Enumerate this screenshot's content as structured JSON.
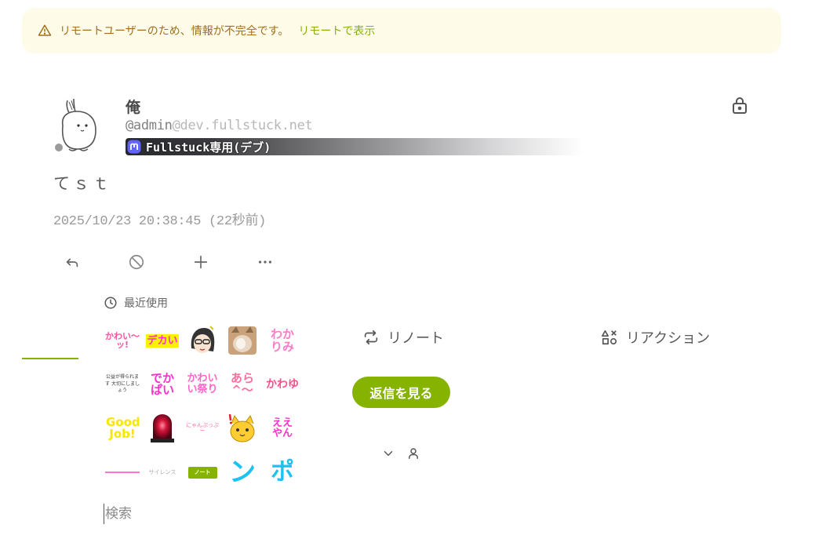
{
  "banner": {
    "message": "リモートユーザーのため、情報が不完全です。",
    "link": "リモートで表示",
    "icon": "warning-icon"
  },
  "note": {
    "display_name": "俺",
    "username": "@admin",
    "host": "@dev.fullstuck.net",
    "instance_name": "Fullstuck専用(デブ)",
    "text": "てｓｔ",
    "date": "2025/10/23 20:38:45 (22秒前)"
  },
  "actions": [
    {
      "name": "reply-icon"
    },
    {
      "name": "renote-disabled-icon"
    },
    {
      "name": "add-reaction-icon"
    },
    {
      "name": "more-icon"
    }
  ],
  "tabs": {
    "renote": "リノート",
    "reaction": "リアクション"
  },
  "view_replies_label": "返信を見る",
  "picker": {
    "header": "最近使用",
    "search_placeholder": "検索",
    "emojis": [
      {
        "label": "かわい〜ッ!",
        "color": "#ff4fa3"
      },
      {
        "label": "デカい",
        "color": "#ff2fd0"
      },
      {
        "label": "",
        "color": "#333333"
      },
      {
        "label": "",
        "color": "#b98a5a"
      },
      {
        "label": "わかりみ",
        "color": "#ff7cc9"
      },
      {
        "label": "公益が得られます 大切にしましょう",
        "color": "#333333"
      },
      {
        "label": "でかぱい",
        "color": "#ff2fd0"
      },
      {
        "label": "かわいい祭り",
        "color": "#ff66cc"
      },
      {
        "label": "あら^〜",
        "color": "#ff6fa0"
      },
      {
        "label": "かわゆ",
        "color": "#ff4f8a"
      },
      {
        "label": "Good Job!",
        "color": "#f6e600"
      },
      {
        "label": "",
        "color": "#d4143a"
      },
      {
        "label": "にゃんぷっぷー",
        "color": "#ff6fa0"
      },
      {
        "label": "",
        "color": "#ffcc33"
      },
      {
        "label": "ええやん",
        "color": "#ff2fd0"
      },
      {
        "label": "",
        "color": "#ff77cc"
      },
      {
        "label": "サイレンス",
        "color": "#aaaaaa"
      },
      {
        "label": "ノート",
        "color": "#86b300"
      },
      {
        "label": "ン",
        "color": "#1cc3f0"
      },
      {
        "label": "ポ",
        "color": "#1cc3f0"
      }
    ]
  },
  "colors": {
    "accent": "#86b300",
    "banner_bg": "#fefce8",
    "banner_text": "#a26e1c"
  }
}
